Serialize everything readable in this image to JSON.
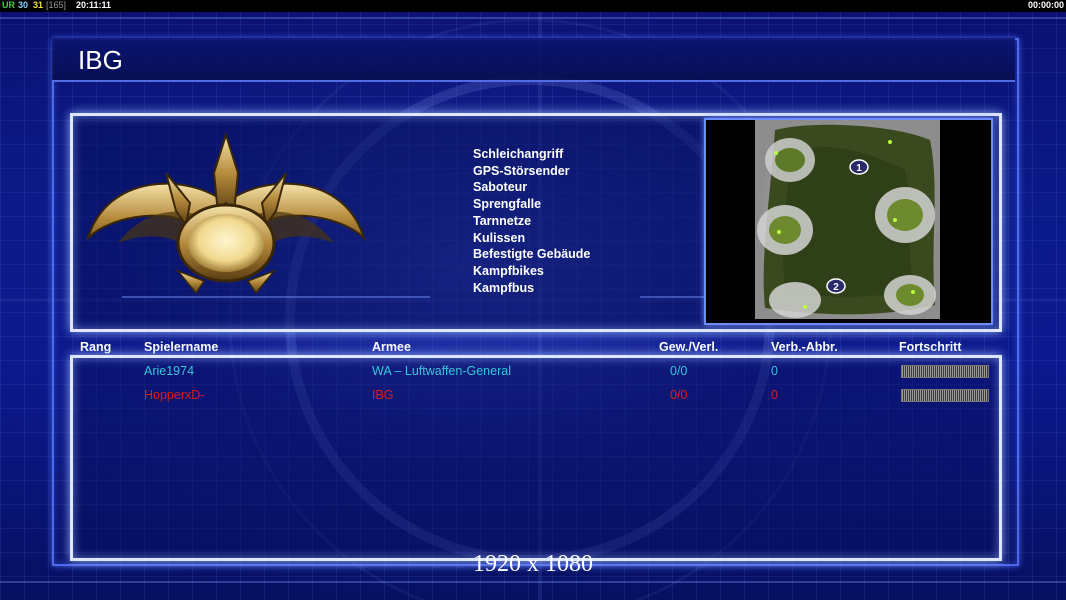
{
  "topbar": {
    "ur_label": "UR",
    "val1": "30",
    "val2": "31",
    "val3": "[165]",
    "clock": "20:11:11",
    "timer": "00:00:00"
  },
  "game": {
    "title": "IBG",
    "rules": [
      "Schleichangriff",
      "GPS-Störsender",
      "Saboteur",
      "Sprengfalle",
      "Tarnnetze",
      "Kulissen",
      "Befestigte Gebäude",
      "Kampfbikes",
      "Kampfbus"
    ],
    "map_start_labels": [
      "1",
      "2"
    ]
  },
  "table": {
    "headers": {
      "rank": "Rang",
      "player": "Spielername",
      "army": "Armee",
      "winloss": "Gew./Verl.",
      "disconnects": "Verb.-Abbr.",
      "progress": "Fortschritt"
    },
    "rows": [
      {
        "name": "Arie1974",
        "army": "WA – Luftwaffen-General",
        "winloss": "0/0",
        "disconnects": "0",
        "color": "#39c6d8"
      },
      {
        "name": "HopperxD-",
        "army": "IBG",
        "winloss": "0/0",
        "disconnects": "0",
        "color": "#e01a1a"
      }
    ]
  },
  "footer": {
    "resolution": "1920 x 1080"
  },
  "colors": {
    "background": "#0a1a8a",
    "panel_border": "#dfe6ff",
    "player1": "#39c6d8",
    "player2": "#e01a1a",
    "topbar_green": "#3ed13e",
    "topbar_yellow": "#f2e23a"
  }
}
